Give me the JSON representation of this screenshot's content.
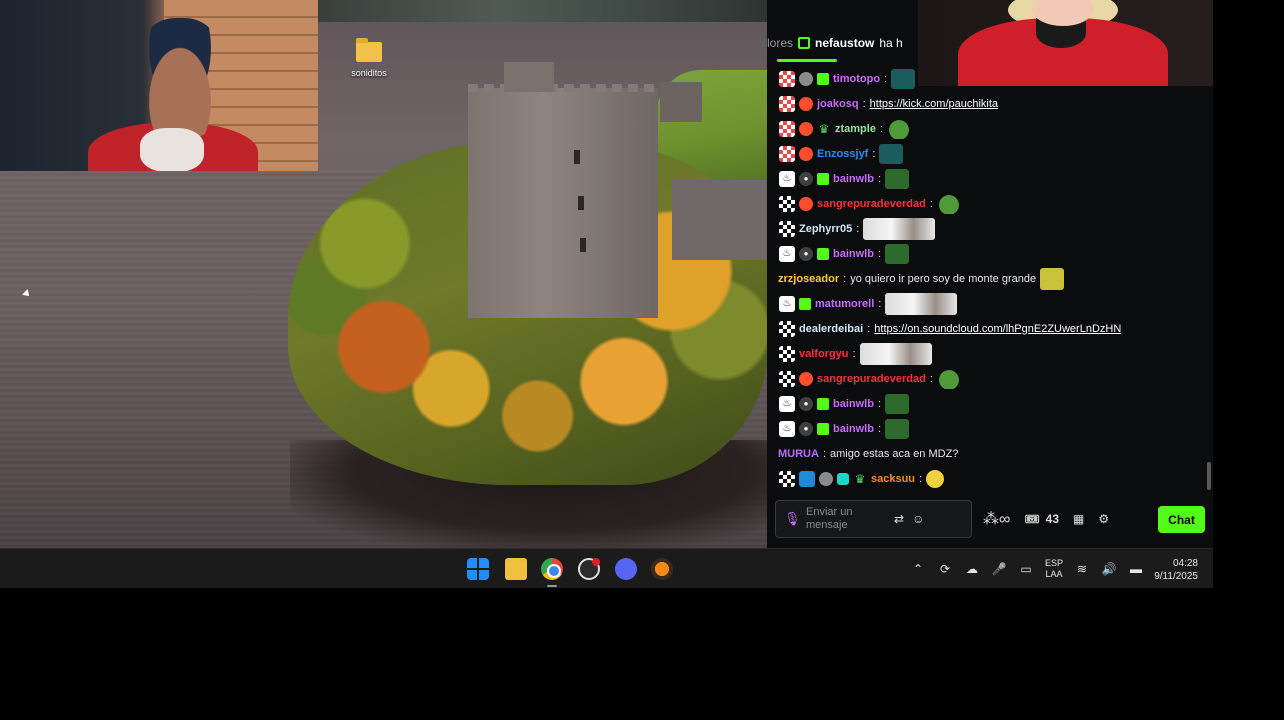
{
  "desktop": {
    "icon_label": "soniditos"
  },
  "chat": {
    "pinned": {
      "prefix": "lores",
      "user": "nefaustow",
      "text": "ha h"
    },
    "messages": [
      {
        "user": "timotopo",
        "color": "#c86bff",
        "text": ""
      },
      {
        "user": "joakosq",
        "color": "#c86bff",
        "link": "https://kick.com/pauchikita"
      },
      {
        "user": "ztample",
        "color": "#8fe8a0",
        "text": ""
      },
      {
        "user": "Enzossjyf",
        "color": "#2a8cff",
        "text": ""
      },
      {
        "user": "bainwlb",
        "color": "#c86bff",
        "text": ""
      },
      {
        "user": "sangrepuradeverdad",
        "color": "#ff2e3c",
        "text": ""
      },
      {
        "user": "Zephyrr05",
        "color": "#cfe8ff",
        "text": ""
      },
      {
        "user": "bainwlb",
        "color": "#c86bff",
        "text": ""
      },
      {
        "user": "zrzjoseador",
        "color": "#ffcc33",
        "text": "yo quiero ir pero soy de monte grande"
      },
      {
        "user": "matumorell",
        "color": "#c86bff",
        "text": ""
      },
      {
        "user": "dealerdeibai",
        "color": "#cfe8ff",
        "link": "https://on.soundcloud.com/lhPgnE2ZUwerLnDzHN"
      },
      {
        "user": "valforgyu",
        "color": "#ff2e3c",
        "text": ""
      },
      {
        "user": "sangrepuradeverdad",
        "color": "#ff2e3c",
        "text": ""
      },
      {
        "user": "bainwlb",
        "color": "#c86bff",
        "text": ""
      },
      {
        "user": "bainwlb",
        "color": "#c86bff",
        "text": ""
      },
      {
        "user": "MURUA",
        "color": "#b96bff",
        "text": "amigo estas aca en MDZ?"
      },
      {
        "user": "sacksuu",
        "color": "#ff8a1f",
        "text": ""
      }
    ],
    "input_placeholder": "Enviar un mensaje",
    "points": "43",
    "chat_button": "Chat",
    "accent": "#53fc18"
  },
  "taskbar": {
    "lang_top": "ESP",
    "lang_bottom": "LAA",
    "time": "04:28",
    "date": "9/11/2025"
  }
}
